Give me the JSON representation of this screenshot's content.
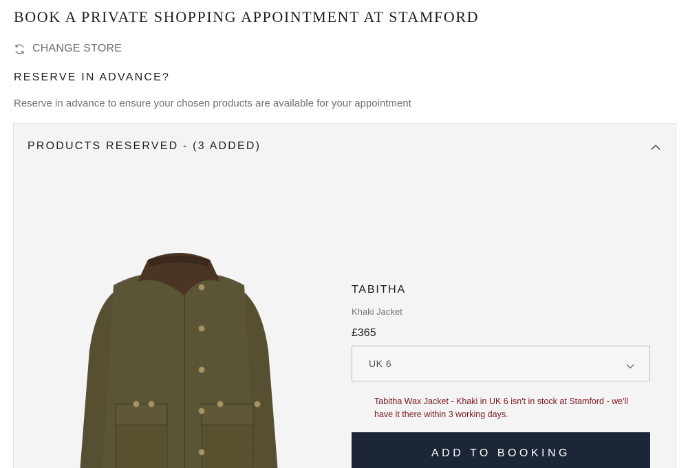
{
  "page": {
    "title": "BOOK A PRIVATE SHOPPING APPOINTMENT AT STAMFORD",
    "change_store_label": "CHANGE STORE",
    "change_store_icon": "refresh-icon",
    "reserve_heading": "RESERVE IN ADVANCE?",
    "reserve_description": "Reserve in advance to ensure your chosen products are available for your appointment"
  },
  "panel": {
    "title": "PRODUCTS RESERVED  - (3 ADDED)",
    "toggle_icon": "chevron-up-icon",
    "expanded": true
  },
  "product": {
    "name": "TABITHA",
    "description": "Khaki Jacket",
    "price": "£365",
    "size_selected": "UK 6",
    "size_icon": "chevron-down-icon",
    "stock_message": "Tabitha Wax Jacket - Khaki in UK 6 isn't in stock at Stamford - we'll have it there within 3 working days.",
    "add_button_label": "ADD TO BOOKING",
    "image_icon": "khaki-wax-jacket-image"
  },
  "colors": {
    "panel_background": "#f4f4f4",
    "button_background": "#1c2637",
    "error_text": "#7a1420",
    "jacket_body": "#5b5537",
    "jacket_collar": "#4a3424"
  }
}
